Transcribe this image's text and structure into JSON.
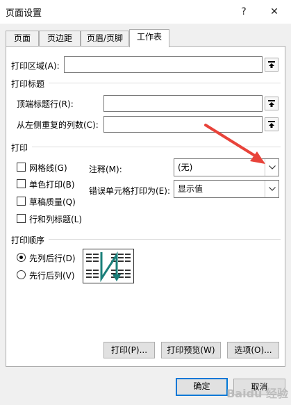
{
  "window": {
    "title": "页面设置",
    "help_label": "?",
    "close_label": "✕"
  },
  "tabs": [
    {
      "label": "页面",
      "active": false
    },
    {
      "label": "页边距",
      "active": false
    },
    {
      "label": "页眉/页脚",
      "active": false
    },
    {
      "label": "工作表",
      "active": true
    }
  ],
  "print_area": {
    "label": "打印区域(A):",
    "value": ""
  },
  "print_titles": {
    "section_label": "打印标题",
    "rows_label": "顶端标题行(R):",
    "rows_value": "",
    "cols_label": "从左侧重复的列数(C):",
    "cols_value": ""
  },
  "print": {
    "section_label": "打印",
    "checkboxes": [
      {
        "label": "网格线(G)",
        "checked": false
      },
      {
        "label": "单色打印(B)",
        "checked": false
      },
      {
        "label": "草稿质量(Q)",
        "checked": false
      },
      {
        "label": "行和列标题(L)",
        "checked": false
      }
    ],
    "comments_label": "注释(M):",
    "comments_value": "(无)",
    "errors_label": "错误单元格打印为(E):",
    "errors_value": "显示值"
  },
  "page_order": {
    "section_label": "打印顺序",
    "options": [
      {
        "label": "先列后行(D)",
        "selected": true
      },
      {
        "label": "先行后列(V)",
        "selected": false
      }
    ]
  },
  "actions": {
    "print_label": "打印(P)...",
    "preview_label": "打印预览(W)",
    "options_label": "选项(O)..."
  },
  "footer": {
    "ok_label": "确定",
    "cancel_label": "取消"
  },
  "colors": {
    "accent": "#0078d7",
    "annotation_arrow": "#e8433a",
    "diagram_arrow": "#1a7f7a"
  },
  "watermark": "Baidu 经验"
}
